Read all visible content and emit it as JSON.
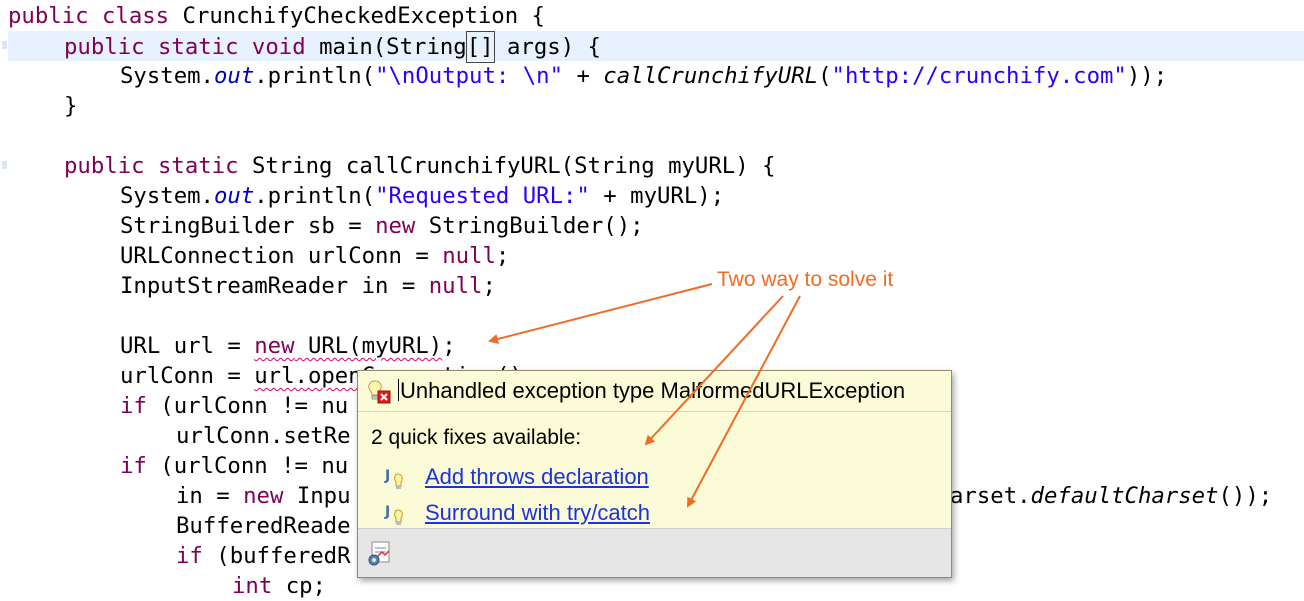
{
  "editor": {
    "line1_kw": "public class ",
    "line1_rest": "CrunchifyCheckedException {",
    "line2_kw": "public static void ",
    "line2_a": "main(String",
    "line2_bracket": "[]",
    "line2_b": " args) {",
    "line3_a": "System.",
    "line3_out": "out",
    "line3_b": ".println(",
    "line3_str": "\"\\nOutput: \\n\"",
    "line3_c": " + ",
    "line3_call": "callCrunchifyURL",
    "line3_d": "(",
    "line3_str2": "\"http://crunchify.com\"",
    "line3_e": "));",
    "line4": "}",
    "line6_kw": "public static ",
    "line6_rest": "String callCrunchifyURL(String myURL) {",
    "line7_a": "System.",
    "line7_out": "out",
    "line7_b": ".println(",
    "line7_str": "\"Requested URL:\"",
    "line7_c": " + myURL);",
    "line8_a": "StringBuilder sb = ",
    "line8_kw": "new",
    "line8_b": " StringBuilder();",
    "line9_a": "URLConnection urlConn = ",
    "line9_kw": "null",
    "line9_b": ";",
    "line10_a": "InputStreamReader in = ",
    "line10_kw": "null",
    "line10_b": ";",
    "line12_a": "URL url = ",
    "line12_kw": "new",
    "line12_err": " URL(myURL)",
    "line12_b": ";",
    "line13_a": "urlConn = ",
    "line13_err": "url.openConnection",
    "line13_b": "();",
    "line14_kw": "if",
    "line14_a": " (urlConn != nu",
    "line15_a": "urlConn.setRe",
    "line16_kw": "if",
    "line16_a": " (urlConn != nu",
    "line17_a": "in = ",
    "line17_kw": "new",
    "line17_b": " Inpu",
    "line17_c": "arset.",
    "line17_it": "defaultCharset",
    "line17_d": "());",
    "line18_a": "BufferedReade",
    "line19_kw": "if",
    "line19_a": " (bufferedR",
    "line20_kw": "int",
    "line20_a": " cp;"
  },
  "hover": {
    "message": "Unhandled exception type MalformedURLException",
    "fix_count": "2 quick fixes available:",
    "fixes": [
      {
        "label": "Add throws declaration"
      },
      {
        "label": "Surround with try/catch"
      }
    ]
  },
  "annotation": {
    "text": "Two way to solve it",
    "color": "#f06c25"
  },
  "colors": {
    "keyword": "#7f0055",
    "string": "#2a00ff",
    "field": "#0000c0",
    "current_line": "#e8f2fe",
    "hover_bg": "#fbfbd7",
    "link": "#1a33dd"
  },
  "icons": [
    "error-lightbulb-icon",
    "java-quick-fix-icon",
    "java-quick-fix-icon",
    "configure-icon"
  ]
}
